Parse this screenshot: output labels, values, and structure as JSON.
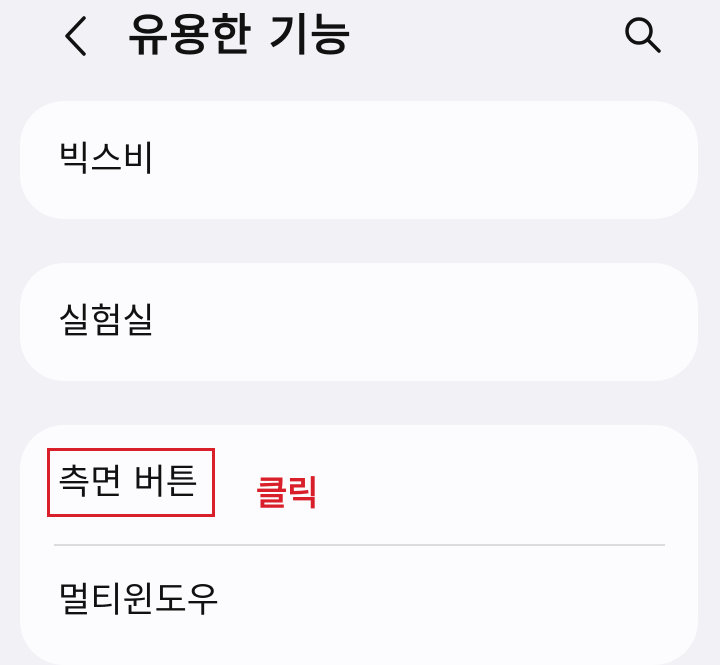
{
  "header": {
    "title": "유용한 기능",
    "back_icon": "chevron-left-icon",
    "search_icon": "search-icon"
  },
  "items": {
    "bixby": "빅스비",
    "labs": "실험실",
    "side_button": "측면 버튼",
    "multi_window": "멀티윈도우"
  },
  "annotation": {
    "text": "클릭",
    "color": "#d9202a"
  }
}
